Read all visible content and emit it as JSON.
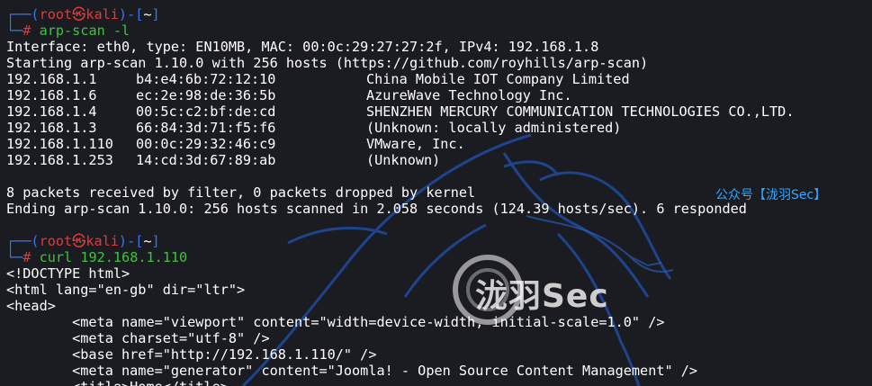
{
  "prompt": {
    "bracket_open": "┌──(",
    "user": "root",
    "at_symbol": "㉿",
    "host": "kali",
    "bracket_mid": ")-[",
    "path": "~",
    "bracket_close": "]",
    "line2_prefix": "└─",
    "hash": "#"
  },
  "commands": [
    "arp-scan -l",
    "curl 192.168.1.110"
  ],
  "arp_output": {
    "interface_line": "Interface: eth0, type: EN10MB, MAC: 00:0c:29:27:27:2f, IPv4: 192.168.1.8",
    "start_line": "Starting arp-scan 1.10.0 with 256 hosts (https://github.com/royhills/arp-scan)",
    "hosts": [
      {
        "ip": "192.168.1.1",
        "mac": "b4:e4:6b:72:12:10",
        "vendor": "China Mobile IOT Company Limited"
      },
      {
        "ip": "192.168.1.6",
        "mac": "ec:2e:98:de:36:5b",
        "vendor": "AzureWave Technology Inc."
      },
      {
        "ip": "192.168.1.4",
        "mac": "00:5c:c2:bf:de:cd",
        "vendor": "SHENZHEN MERCURY COMMUNICATION TECHNOLOGIES CO.,LTD."
      },
      {
        "ip": "192.168.1.3",
        "mac": "66:84:3d:71:f5:f6",
        "vendor": "(Unknown: locally administered)"
      },
      {
        "ip": "192.168.1.110",
        "mac": "00:0c:29:32:46:c9",
        "vendor": "VMware, Inc."
      },
      {
        "ip": "192.168.1.253",
        "mac": "14:cd:3d:67:89:ab",
        "vendor": "(Unknown)"
      }
    ],
    "packets_line": "8 packets received by filter, 0 packets dropped by kernel",
    "ending_line": "Ending arp-scan 1.10.0: 256 hosts scanned in 2.058 seconds (124.39 hosts/sec). 6 responded"
  },
  "curl_output": [
    "<!DOCTYPE html>",
    "<html lang=\"en-gb\" dir=\"ltr\">",
    "<head>",
    "        <meta name=\"viewport\" content=\"width=device-width, initial-scale=1.0\" />",
    "        <meta charset=\"utf-8\" />",
    "        <base href=\"http://192.168.1.110/\" />",
    "        <meta name=\"generator\" content=\"Joomla! - Open Source Content Management\" />",
    "        <title>Home</title>"
  ],
  "watermark": "公众号【泷羽Sec】",
  "logo_text": "泷羽Sec",
  "colors": {
    "background": "#1b1c22",
    "prompt_blue": "#3e73e8",
    "prompt_red": "#e03a3a",
    "command_green": "#3fc23f",
    "watermark_blue": "#2fa8ff"
  }
}
